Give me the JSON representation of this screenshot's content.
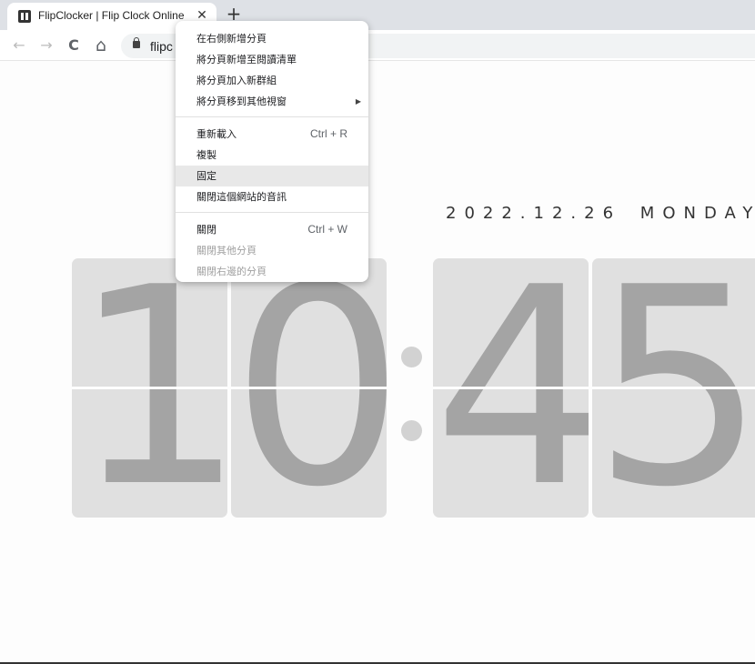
{
  "browser": {
    "tab_title": "FlipClocker | Flip Clock Online a",
    "tab_close": "✕",
    "new_tab": "+",
    "back": "←",
    "forward": "→",
    "reload": "C",
    "home": "⌂",
    "url": "flipc"
  },
  "clock": {
    "date": "2022.12.26",
    "weekday": "MONDAY",
    "hour_tens": "1",
    "hour_ones": "0",
    "minute_tens": "4",
    "minute_ones": "5"
  },
  "context_menu": {
    "new_tab_right": "在右側新增分頁",
    "add_reading_list": "將分頁新增至閱讀清單",
    "add_to_group": "將分頁加入新群組",
    "move_to_window": "將分頁移到其他視窗",
    "reload": "重新載入",
    "reload_shortcut": "Ctrl + R",
    "duplicate": "複製",
    "pin": "固定",
    "mute_site": "關閉這個網站的音訊",
    "close": "關閉",
    "close_shortcut": "Ctrl + W",
    "close_others": "關閉其他分頁",
    "close_right": "關閉右邊的分頁",
    "submenu_arrow": "▶"
  },
  "icons": {
    "favicon": "flipclocker-logo-icon",
    "lock": "lock-icon"
  },
  "colors": {
    "card_bg": "#e0e0e0",
    "digit": "#a4a4a4",
    "colon": "#d2d2d2",
    "menu_highlight": "#e8e8e8"
  }
}
